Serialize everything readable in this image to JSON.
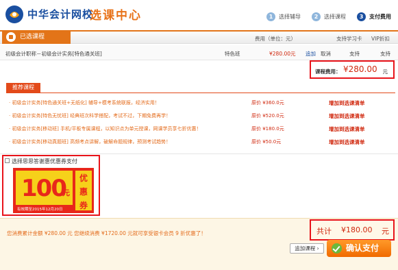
{
  "header": {
    "logo_text": "中华会计网校",
    "page_title": "选课中心",
    "steps": [
      {
        "num": "1",
        "label": "选择辅导"
      },
      {
        "num": "2",
        "label": "选择课程"
      },
      {
        "num": "3",
        "label": "支付费用"
      }
    ]
  },
  "section": {
    "tab_label": "已选课程",
    "col_fee": "费用（单位：元）",
    "col_card": "支持学习卡",
    "col_vip": "VIP折扣"
  },
  "course": {
    "name": "初级会计职称－初级会计实务[特色通关班]",
    "type": "特色班",
    "price": "¥280.00元",
    "add": "追加",
    "cancel": "取消",
    "card": "支持",
    "vip": "支持"
  },
  "fee": {
    "label": "课程费用：",
    "value": "¥280.00",
    "unit": "元"
  },
  "recommend": {
    "heading": "推荐课程",
    "items": [
      {
        "title": "· 初级会计实务[特色通关班+无纸化] 辅导+模考系统联报，经济实用！",
        "price": "原价 ¥360.0元",
        "action": "增加到选课清单"
      },
      {
        "title": "· 初级会计实务[特色无忧班] 经典班次科学搭配，考试不过，下期免费再学！",
        "price": "原价 ¥520.0元",
        "action": "增加到选课清单"
      },
      {
        "title": "· 初级会计实务[移动班] 手机/平板专属课程，以知识点为单元授课，网课学员享七折优惠！",
        "price": "原价 ¥180.0元",
        "action": "增加到选课清单"
      },
      {
        "title": "· 初级会计实务[移动真题班] 高频考点讲解，破解命题规律，预测考试趋势！",
        "price": "原价 ¥50.0元",
        "action": "增加到选课清单"
      }
    ]
  },
  "coupon": {
    "label": "选择思思答谢惠优惠券支付",
    "amount": "100",
    "currency": "元",
    "tag_chars": [
      "优",
      "惠",
      "券"
    ],
    "valid": "有效期至2015年12月20日"
  },
  "footer": {
    "consume_text": "您消费累计金额 ¥280.00 元 您继续消费 ¥1720.00 元就可享受银卡会员 9 折优惠了！",
    "total_label": "共计",
    "total_value": "¥180.00",
    "total_unit": "元",
    "add_button": "追加课程 ›",
    "confirm_button": "确认支付"
  },
  "colors": {
    "brand_blue": "#1a4fa0",
    "accent_orange": "#e37418",
    "price_red": "#d0280e",
    "highlight_border": "#e8131a"
  }
}
